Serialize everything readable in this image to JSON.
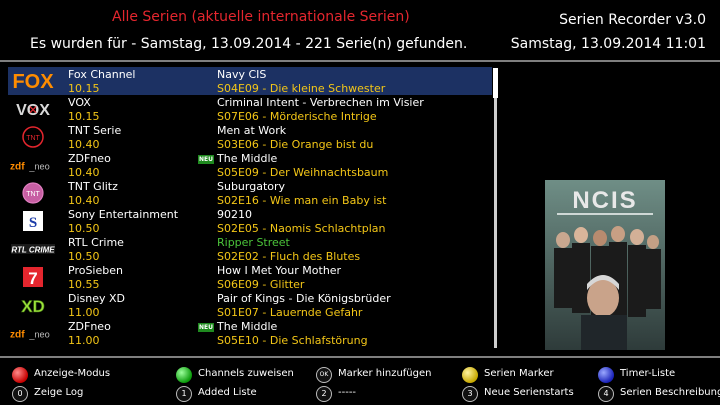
{
  "header": {
    "title": "Alle Serien (aktuelle internationale Serien)",
    "found": "Es wurden für - Samstag, 13.09.2014 - 221 Serie(n) gefunden.",
    "app_title": "Serien Recorder v3.0",
    "datetime": "Samstag, 13.09.2014  11:01"
  },
  "rows": [
    {
      "channel": "Fox Channel",
      "time": "10.15",
      "series": "Navy CIS",
      "episode": "S04E09 - Die kleine Schwester",
      "logo": "FOX",
      "neu": "",
      "selected": true
    },
    {
      "channel": "VOX",
      "time": "10.15",
      "series": "Criminal Intent - Verbrechen im Visier",
      "episode": "S07E06 - Mörderische Intrige",
      "logo": "VOX",
      "neu": ""
    },
    {
      "channel": "TNT Serie",
      "time": "10.40",
      "series": "Men at Work",
      "episode": "S03E06 - Die Orange bist du",
      "logo": "TNT",
      "neu": ""
    },
    {
      "channel": "ZDFneo",
      "time": "10.40",
      "series": "The Middle",
      "episode": "S05E09 - Der Weihnachtsbaum",
      "logo": "zdf_neo",
      "neu": "NEU"
    },
    {
      "channel": "TNT Glitz",
      "time": "10.40",
      "series": "Suburgatory",
      "episode": "S02E16 - Wie man ein Baby ist",
      "logo": "TNT",
      "neu": ""
    },
    {
      "channel": "Sony Entertainment",
      "time": "10.50",
      "series": "90210",
      "episode": "S02E05 - Naomis Schlachtplan",
      "logo": "S",
      "neu": ""
    },
    {
      "channel": "RTL Crime",
      "time": "10.50",
      "series": "Ripper Street",
      "episode": "S02E02 - Fluch des Blutes",
      "logo": "RTL CRIME",
      "neu": "",
      "green": true
    },
    {
      "channel": "ProSieben",
      "time": "10.55",
      "series": "How I Met Your Mother",
      "episode": "S06E09 - Glitter",
      "logo": "7",
      "neu": ""
    },
    {
      "channel": "Disney XD",
      "time": "11.00",
      "series": "Pair of Kings - Die Königsbrüder",
      "episode": "S01E07 - Lauernde Gefahr",
      "logo": "XD",
      "neu": ""
    },
    {
      "channel": "ZDFneo",
      "time": "11.00",
      "series": "The Middle",
      "episode": "S05E10 - Die Schlafstörung",
      "logo": "zdf_neo",
      "neu": "NEU"
    }
  ],
  "poster": {
    "title": "NCIS"
  },
  "footer": {
    "red": "Anzeige-Modus",
    "green": "Channels zuweisen",
    "ok": "Marker hinzufügen",
    "yellow": "Serien Marker",
    "blue": "Timer-Liste",
    "k0": "Zeige Log",
    "k1": "Added Liste",
    "k2": "-----",
    "k3": "Neue Serienstarts",
    "k4": "Serien Beschreibung",
    "key_ok": "OK",
    "key_0": "0",
    "key_1": "1",
    "key_2": "2",
    "key_3": "3",
    "key_4": "4"
  },
  "colors": {
    "title_red": "#e4262e",
    "time_yellow": "#f3c617",
    "selection": "#1c3163",
    "green_text": "#4bc43a"
  }
}
